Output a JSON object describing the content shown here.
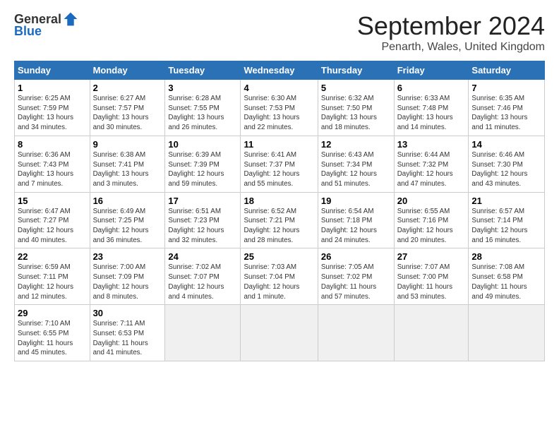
{
  "header": {
    "logo_general": "General",
    "logo_blue": "Blue",
    "month_title": "September 2024",
    "location": "Penarth, Wales, United Kingdom"
  },
  "weekdays": [
    "Sunday",
    "Monday",
    "Tuesday",
    "Wednesday",
    "Thursday",
    "Friday",
    "Saturday"
  ],
  "weeks": [
    [
      {
        "day": "1",
        "sunrise": "6:25 AM",
        "sunset": "7:59 PM",
        "daylight": "13 hours and 34 minutes."
      },
      {
        "day": "2",
        "sunrise": "6:27 AM",
        "sunset": "7:57 PM",
        "daylight": "13 hours and 30 minutes."
      },
      {
        "day": "3",
        "sunrise": "6:28 AM",
        "sunset": "7:55 PM",
        "daylight": "13 hours and 26 minutes."
      },
      {
        "day": "4",
        "sunrise": "6:30 AM",
        "sunset": "7:53 PM",
        "daylight": "13 hours and 22 minutes."
      },
      {
        "day": "5",
        "sunrise": "6:32 AM",
        "sunset": "7:50 PM",
        "daylight": "13 hours and 18 minutes."
      },
      {
        "day": "6",
        "sunrise": "6:33 AM",
        "sunset": "7:48 PM",
        "daylight": "13 hours and 14 minutes."
      },
      {
        "day": "7",
        "sunrise": "6:35 AM",
        "sunset": "7:46 PM",
        "daylight": "13 hours and 11 minutes."
      }
    ],
    [
      {
        "day": "8",
        "sunrise": "6:36 AM",
        "sunset": "7:43 PM",
        "daylight": "13 hours and 7 minutes."
      },
      {
        "day": "9",
        "sunrise": "6:38 AM",
        "sunset": "7:41 PM",
        "daylight": "13 hours and 3 minutes."
      },
      {
        "day": "10",
        "sunrise": "6:39 AM",
        "sunset": "7:39 PM",
        "daylight": "12 hours and 59 minutes."
      },
      {
        "day": "11",
        "sunrise": "6:41 AM",
        "sunset": "7:37 PM",
        "daylight": "12 hours and 55 minutes."
      },
      {
        "day": "12",
        "sunrise": "6:43 AM",
        "sunset": "7:34 PM",
        "daylight": "12 hours and 51 minutes."
      },
      {
        "day": "13",
        "sunrise": "6:44 AM",
        "sunset": "7:32 PM",
        "daylight": "12 hours and 47 minutes."
      },
      {
        "day": "14",
        "sunrise": "6:46 AM",
        "sunset": "7:30 PM",
        "daylight": "12 hours and 43 minutes."
      }
    ],
    [
      {
        "day": "15",
        "sunrise": "6:47 AM",
        "sunset": "7:27 PM",
        "daylight": "12 hours and 40 minutes."
      },
      {
        "day": "16",
        "sunrise": "6:49 AM",
        "sunset": "7:25 PM",
        "daylight": "12 hours and 36 minutes."
      },
      {
        "day": "17",
        "sunrise": "6:51 AM",
        "sunset": "7:23 PM",
        "daylight": "12 hours and 32 minutes."
      },
      {
        "day": "18",
        "sunrise": "6:52 AM",
        "sunset": "7:21 PM",
        "daylight": "12 hours and 28 minutes."
      },
      {
        "day": "19",
        "sunrise": "6:54 AM",
        "sunset": "7:18 PM",
        "daylight": "12 hours and 24 minutes."
      },
      {
        "day": "20",
        "sunrise": "6:55 AM",
        "sunset": "7:16 PM",
        "daylight": "12 hours and 20 minutes."
      },
      {
        "day": "21",
        "sunrise": "6:57 AM",
        "sunset": "7:14 PM",
        "daylight": "12 hours and 16 minutes."
      }
    ],
    [
      {
        "day": "22",
        "sunrise": "6:59 AM",
        "sunset": "7:11 PM",
        "daylight": "12 hours and 12 minutes."
      },
      {
        "day": "23",
        "sunrise": "7:00 AM",
        "sunset": "7:09 PM",
        "daylight": "12 hours and 8 minutes."
      },
      {
        "day": "24",
        "sunrise": "7:02 AM",
        "sunset": "7:07 PM",
        "daylight": "12 hours and 4 minutes."
      },
      {
        "day": "25",
        "sunrise": "7:03 AM",
        "sunset": "7:04 PM",
        "daylight": "12 hours and 1 minute."
      },
      {
        "day": "26",
        "sunrise": "7:05 AM",
        "sunset": "7:02 PM",
        "daylight": "11 hours and 57 minutes."
      },
      {
        "day": "27",
        "sunrise": "7:07 AM",
        "sunset": "7:00 PM",
        "daylight": "11 hours and 53 minutes."
      },
      {
        "day": "28",
        "sunrise": "7:08 AM",
        "sunset": "6:58 PM",
        "daylight": "11 hours and 49 minutes."
      }
    ],
    [
      {
        "day": "29",
        "sunrise": "7:10 AM",
        "sunset": "6:55 PM",
        "daylight": "11 hours and 45 minutes."
      },
      {
        "day": "30",
        "sunrise": "7:11 AM",
        "sunset": "6:53 PM",
        "daylight": "11 hours and 41 minutes."
      },
      null,
      null,
      null,
      null,
      null
    ]
  ]
}
